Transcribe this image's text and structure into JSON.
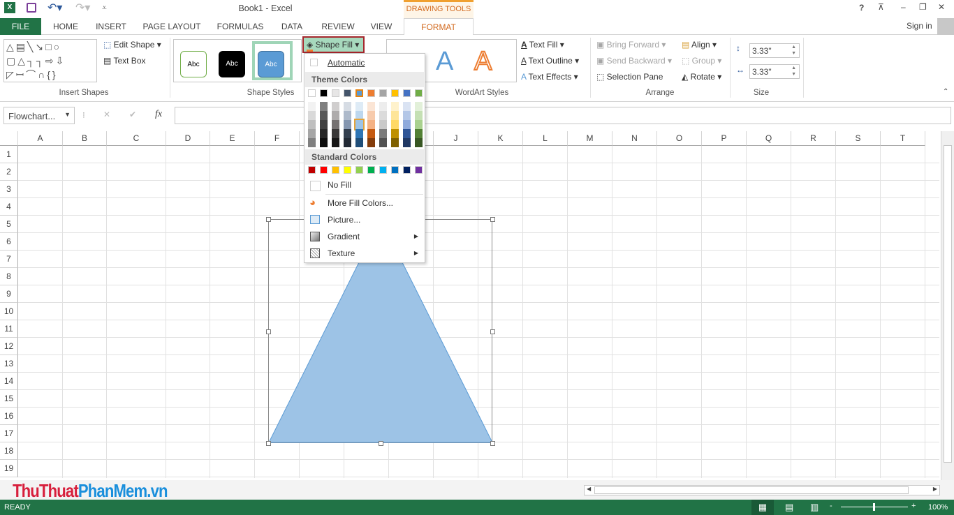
{
  "window": {
    "title": "Book1 - Excel",
    "context_tab": "DRAWING TOOLS",
    "sign_in": "Sign in",
    "help": "?",
    "minimize": "–",
    "restore": "❐",
    "close": "✕"
  },
  "tabs": [
    "FILE",
    "HOME",
    "INSERT",
    "PAGE LAYOUT",
    "FORMULAS",
    "DATA",
    "REVIEW",
    "VIEW",
    "FORMAT"
  ],
  "ribbon": {
    "insert_shapes": {
      "label": "Insert Shapes",
      "edit_shape": "Edit Shape",
      "text_box": "Text Box"
    },
    "shape_styles": {
      "label": "Shape Styles",
      "sample": "Abc",
      "shape_fill": "Shape Fill"
    },
    "wordart": {
      "label": "WordArt Styles",
      "sample": "A",
      "text_fill": "Text Fill",
      "text_outline": "Text Outline",
      "text_effects": "Text Effects"
    },
    "arrange": {
      "label": "Arrange",
      "bring_forward": "Bring Forward",
      "send_backward": "Send Backward",
      "selection_pane": "Selection Pane",
      "align": "Align",
      "group": "Group",
      "rotate": "Rotate"
    },
    "size": {
      "label": "Size",
      "height": "3.33\"",
      "width": "3.33\""
    }
  },
  "formula_bar": {
    "name_box": "Flowchart...",
    "fx": "fx",
    "value": ""
  },
  "columns": [
    "A",
    "B",
    "C",
    "D",
    "E",
    "F",
    "G",
    "H",
    "I",
    "J",
    "K",
    "L",
    "M",
    "N",
    "O",
    "P",
    "Q",
    "R",
    "S",
    "T"
  ],
  "rows": [
    1,
    2,
    3,
    4,
    5,
    6,
    7,
    8,
    9,
    10,
    11,
    12,
    13,
    14,
    15,
    16,
    17,
    18,
    19
  ],
  "fill_menu": {
    "automatic": "Automatic",
    "theme_header": "Theme Colors",
    "standard_header": "Standard Colors",
    "no_fill": "No Fill",
    "more": "More Fill Colors...",
    "picture": "Picture...",
    "gradient": "Gradient",
    "texture": "Texture",
    "theme": [
      "#ffffff",
      "#000000",
      "#e7e6e6",
      "#44546a",
      "#5b9bd5",
      "#ed7d31",
      "#a5a5a5",
      "#ffc000",
      "#4472c4",
      "#70ad47"
    ],
    "shades": [
      [
        "#f2f2f2",
        "#d9d9d9",
        "#bfbfbf",
        "#a6a6a6",
        "#808080"
      ],
      [
        "#808080",
        "#595959",
        "#404040",
        "#262626",
        "#0d0d0d"
      ],
      [
        "#d0cece",
        "#aeabab",
        "#757171",
        "#3a3838",
        "#171616"
      ],
      [
        "#d6dce4",
        "#adb9ca",
        "#8496b0",
        "#333f4f",
        "#222a35"
      ],
      [
        "#deebf6",
        "#bdd7ee",
        "#9dc3e6",
        "#2e75b5",
        "#1f4e79"
      ],
      [
        "#fbe5d5",
        "#f7cbac",
        "#f4b183",
        "#c55a11",
        "#843c0b"
      ],
      [
        "#ededed",
        "#dbdbdb",
        "#c9c9c9",
        "#7b7b7b",
        "#525252"
      ],
      [
        "#fff2cc",
        "#fee599",
        "#ffd966",
        "#bf9000",
        "#7f6000"
      ],
      [
        "#dae3f3",
        "#b4c7e7",
        "#8faadc",
        "#2f5597",
        "#203864"
      ],
      [
        "#e2f0d9",
        "#c5e0b4",
        "#a9d18e",
        "#538135",
        "#385723"
      ]
    ],
    "standard": [
      "#c00000",
      "#ff0000",
      "#ffc000",
      "#ffff00",
      "#92d050",
      "#00b050",
      "#00b0f0",
      "#0070c0",
      "#002060",
      "#7030a0"
    ]
  },
  "shape": {
    "fill": "#9dc3e6",
    "stroke": "#5b9bd5"
  },
  "watermark": "ThuThuatPhanMem.vn",
  "status": {
    "ready": "READY",
    "zoom": "100%"
  },
  "colors": {
    "accent": "#217346",
    "format": "#d2691e"
  }
}
